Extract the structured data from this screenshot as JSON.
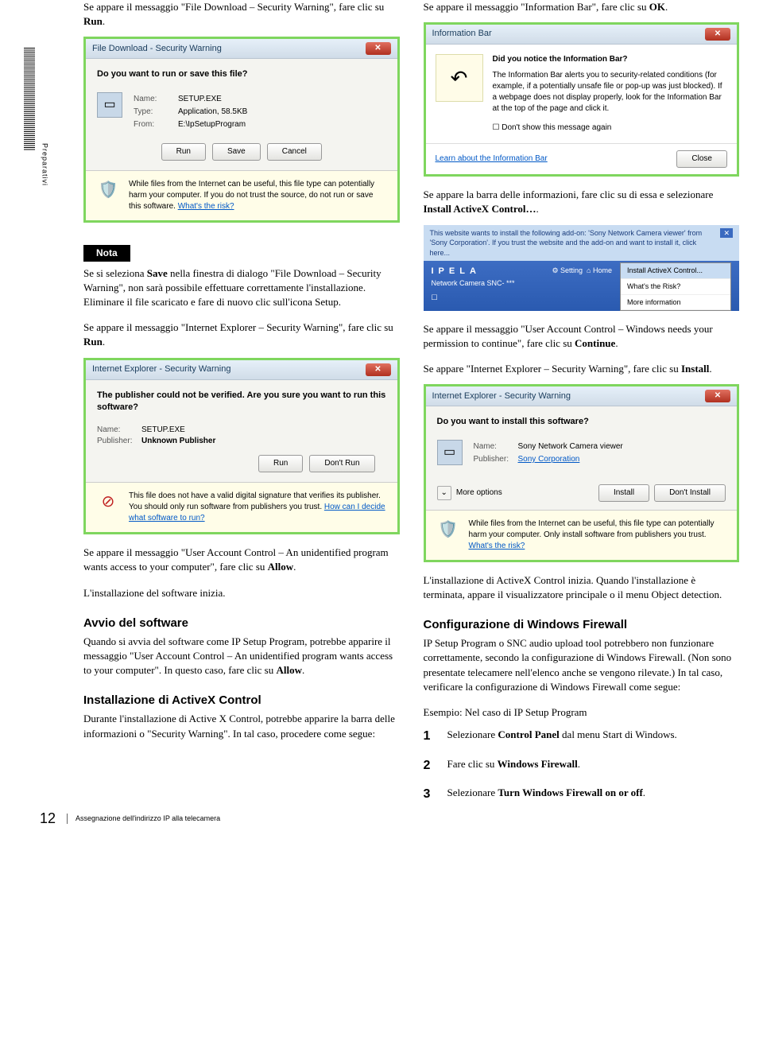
{
  "sidebar_label": "Preparativi",
  "left": {
    "p1_a": "Se appare il messaggio \"File Download – Security Warning\", fare clic su ",
    "p1_b": "Run",
    "p1_c": ".",
    "dlg1": {
      "title": "File Download - Security Warning",
      "q": "Do you want to run or save this file?",
      "name_l": "Name:",
      "name_v": "SETUP.EXE",
      "type_l": "Type:",
      "type_v": "Application, 58.5KB",
      "from_l": "From:",
      "from_v": "E:\\IpSetupProgram",
      "btn_run": "Run",
      "btn_save": "Save",
      "btn_cancel": "Cancel",
      "warn": "While files from the Internet can be useful, this file type can potentially harm your computer. If you do not trust the source, do not run or save this software. ",
      "warn_link": "What's the risk?"
    },
    "nota": "Nota",
    "p2_a": "Se si seleziona ",
    "p2_b": "Save",
    "p2_c": " nella finestra di dialogo \"File Download – Security Warning\", non sarà possibile effettuare correttamente l'installazione. Eliminare il file scaricato e fare di nuovo clic sull'icona Setup.",
    "p3_a": "Se appare il messaggio \"Internet Explorer – Security Warning\", fare clic su ",
    "p3_b": "Run",
    "p3_c": ".",
    "dlg2": {
      "title": "Internet Explorer - Security Warning",
      "q": "The publisher could not be verified. Are you sure you want to run this software?",
      "name_l": "Name:",
      "name_v": "SETUP.EXE",
      "pub_l": "Publisher:",
      "pub_v": "Unknown Publisher",
      "btn_run": "Run",
      "btn_dont": "Don't Run",
      "warn": "This file does not have a valid digital signature that verifies its publisher. You should only run software from publishers you trust. ",
      "warn_link": "How can I decide what software to run?"
    },
    "p4_a": "Se appare il messaggio \"User Account Control – An unidentified program wants access to your computer\", fare clic su ",
    "p4_b": "Allow",
    "p4_c": ".",
    "p5": "L'installazione del software inizia.",
    "h1": "Avvio del software",
    "p6_a": "Quando si avvia del software come IP Setup Program, potrebbe apparire il messaggio  \"User Account Control – An unidentified program wants access to your computer\". In questo caso, fare clic su ",
    "p6_b": "Allow",
    "p6_c": ".",
    "h2": "Installazione di ActiveX Control",
    "p7": "Durante l'installazione di Active X Control, potrebbe apparire la barra delle informazioni o \"Security Warning\". In tal caso, procedere come segue:"
  },
  "right": {
    "p1_a": "Se appare il messaggio \"Information Bar\", fare clic su ",
    "p1_b": "OK",
    "p1_c": ".",
    "dlg3": {
      "title": "Information Bar",
      "h": "Did you notice the Information Bar?",
      "body": "The Information Bar alerts you to security-related conditions (for example, if a potentially unsafe file or pop-up was just blocked). If a webpage does not display properly, look for the Information Bar at the top of the page and click it.",
      "chk": "Don't show this message again",
      "learn": "Learn about the Information Bar",
      "close": "Close"
    },
    "p2_a": "Se appare la barra delle informazioni, fare clic su di essa e selezionare ",
    "p2_b": "Install ActiveX Control…",
    "p2_c": ".",
    "webbar": {
      "msg": "This website wants to install the following add-on: 'Sony Network Camera viewer' from 'Sony Corporation'. If you trust the website and the add-on and want to install it, click here...",
      "menu1": "Install ActiveX Control...",
      "menu2": "What's the Risk?",
      "menu3": "More information",
      "brand": "IPELA",
      "sub": "Network Camera SNC- ***",
      "link1": "Setting",
      "link2": "Home"
    },
    "p3_a": "Se appare il messaggio \"User Account Control – Windows needs your permission to continue\", fare clic su ",
    "p3_b": "Continue",
    "p3_c": ".",
    "p4_a": "Se appare \"Internet Explorer – Security Warning\", fare clic su ",
    "p4_b": "Install",
    "p4_c": ".",
    "dlg4": {
      "title": "Internet Explorer - Security Warning",
      "q": "Do you want to install this software?",
      "name_l": "Name:",
      "name_v": "Sony Network Camera viewer",
      "pub_l": "Publisher:",
      "pub_v": "Sony Corporation",
      "more": "More options",
      "btn_install": "Install",
      "btn_dont": "Don't Install",
      "warn": "While files from the Internet can be useful, this file type can potentially harm your computer. Only install software from publishers you trust. ",
      "warn_link": "What's the risk?"
    },
    "p5": "L'installazione di ActiveX Control inizia. Quando l'installazione è terminata, appare il visualizzatore principale o il menu Object detection.",
    "h1": "Configurazione di Windows Firewall",
    "p6": "IP Setup Program o SNC audio upload tool potrebbero non funzionare correttamente, secondo la configurazione di Windows Firewall. (Non sono presentate telecamere nell'elenco anche se vengono rilevate.) In tal caso, verificare la configurazione di Windows Firewall come segue:",
    "p7": "Esempio: Nel caso di IP Setup Program",
    "step1_a": "Selezionare ",
    "step1_b": "Control Panel",
    "step1_c": " dal menu Start di Windows.",
    "step2_a": "Fare clic su ",
    "step2_b": "Windows Firewall",
    "step2_c": ".",
    "step3_a": "Selezionare ",
    "step3_b": "Turn Windows Firewall on or off",
    "step3_c": "."
  },
  "footer": {
    "page": "12",
    "title": "Assegnazione dell'indirizzo IP alla telecamera"
  }
}
